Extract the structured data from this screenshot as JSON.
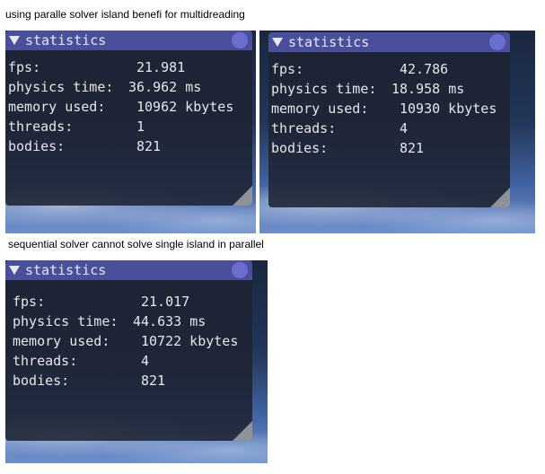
{
  "captions": {
    "top": "using paralle solver island benefi for multidreading",
    "bottom": "sequential solver cannot solve single island in parallel"
  },
  "windows": [
    {
      "title": "statistics",
      "rows": [
        {
          "label": "fps:",
          "value": "21.981"
        },
        {
          "label": "physics time:",
          "value": "36.962 ms"
        },
        {
          "label": "memory used:",
          "value": "10962 kbytes"
        },
        {
          "label": "threads:",
          "value": "1"
        },
        {
          "label": "bodies:",
          "value": "821"
        }
      ]
    },
    {
      "title": "statistics",
      "rows": [
        {
          "label": "fps:",
          "value": "42.786"
        },
        {
          "label": "physics time:",
          "value": "18.958 ms"
        },
        {
          "label": "memory used:",
          "value": "10930 kbytes"
        },
        {
          "label": "threads:",
          "value": "4"
        },
        {
          "label": "bodies:",
          "value": "821"
        }
      ]
    },
    {
      "title": "statistics",
      "rows": [
        {
          "label": "fps:",
          "value": "21.017"
        },
        {
          "label": "physics time:",
          "value": "44.633 ms"
        },
        {
          "label": "memory used:",
          "value": "10722 kbytes"
        },
        {
          "label": "threads:",
          "value": "4"
        },
        {
          "label": "bodies:",
          "value": "821"
        }
      ]
    }
  ],
  "colors": {
    "titlebar": "#4a4f9c",
    "close_button": "#6a6fcf",
    "panel_text": "#e4e6ec"
  }
}
